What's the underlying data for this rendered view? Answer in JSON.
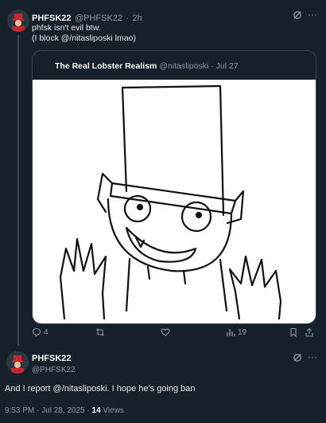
{
  "quoted_post": {
    "author_name": "PHFSK22",
    "author_handle": "@PHFSK22",
    "time": "2h",
    "text_line1": "phfsk isn't evil btw.",
    "text_line2": "(I block @/nitasliposki lmao)",
    "embedded": {
      "author_name": "The Real Lobster Realism",
      "author_handle": "@nitasliposki",
      "date": "Jul 27"
    },
    "stats": {
      "replies": "4",
      "reposts": "",
      "likes": "",
      "views": "19"
    }
  },
  "main_post": {
    "author_name": "PHFSK22",
    "author_handle": "@PHFSK22",
    "text": "And I report @/nitasliposki. I hope he's going ban",
    "timestamp": "9:53 PM · Jul 28, 2025 · ",
    "views_count": "14",
    "views_label": "Views"
  },
  "colors": {
    "background": "#15202b",
    "border": "#38444d",
    "muted": "#8b98a5",
    "avatar_red": "#c1272d"
  },
  "icons": [
    "grok-icon",
    "more-icon",
    "reply-icon",
    "repost-icon",
    "like-icon",
    "views-icon",
    "bookmark-icon",
    "share-icon"
  ]
}
